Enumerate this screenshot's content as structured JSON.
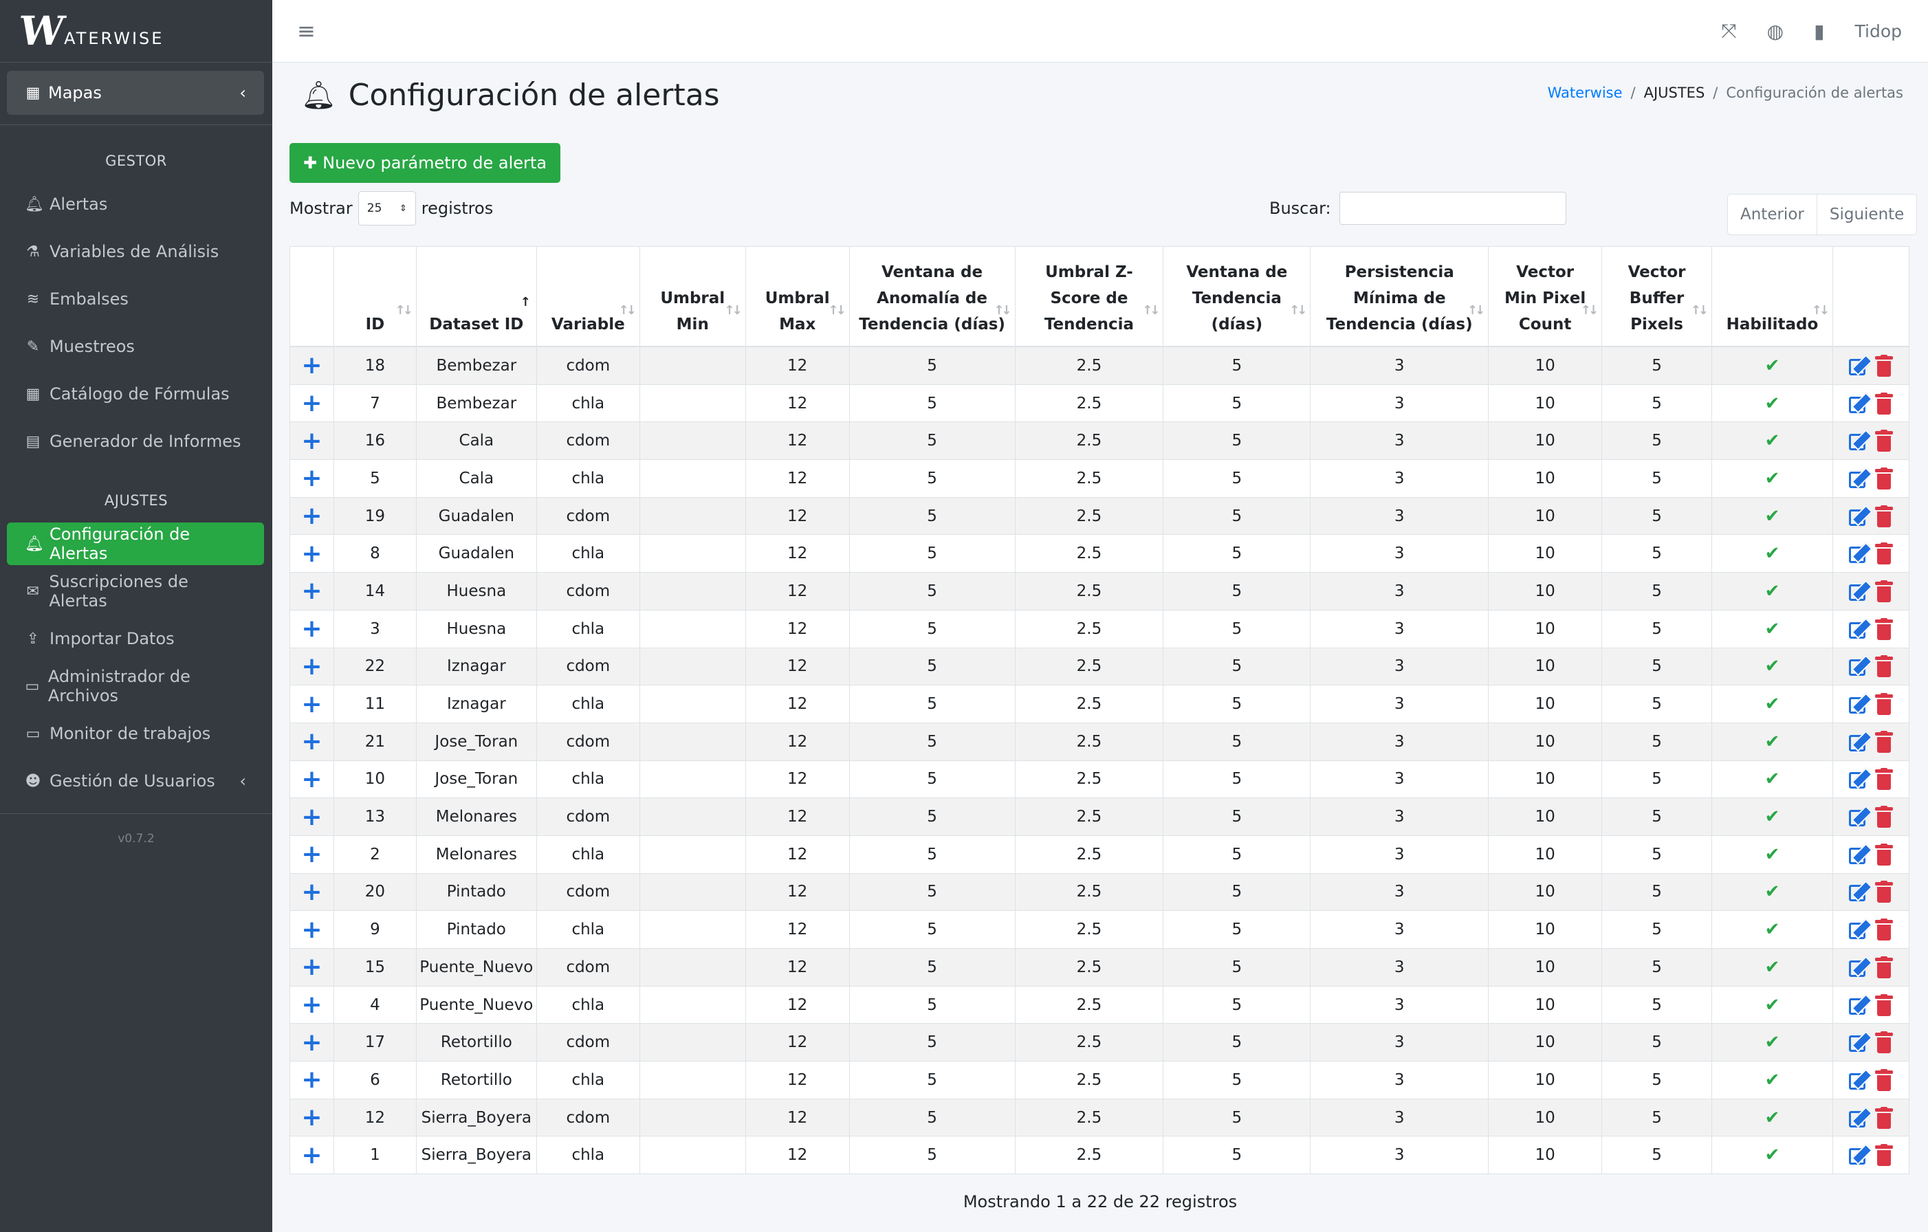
{
  "brand": {
    "logo_letter": "W",
    "logo_text": "ATERWISE"
  },
  "sidebar": {
    "mapas": "Mapas",
    "gestor_header": "GESTOR",
    "gestor_items": [
      {
        "label": "Alertas",
        "icon": "bell-icon"
      },
      {
        "label": "Variables de Análisis",
        "icon": "flask-icon"
      },
      {
        "label": "Embalses",
        "icon": "water-icon"
      },
      {
        "label": "Muestreos",
        "icon": "eyedropper-icon"
      },
      {
        "label": "Catálogo de Fórmulas",
        "icon": "calculator-icon"
      },
      {
        "label": "Generador de Informes",
        "icon": "file-icon"
      }
    ],
    "ajustes_header": "AJUSTES",
    "ajustes_items": [
      {
        "label": "Configuración de Alertas",
        "icon": "bell-icon"
      },
      {
        "label": "Suscripciones de Alertas",
        "icon": "envelope-icon"
      },
      {
        "label": "Importar Datos",
        "icon": "upload-icon"
      },
      {
        "label": "Administrador de Archivos",
        "icon": "folder-icon"
      },
      {
        "label": "Monitor de trabajos",
        "icon": "desktop-icon"
      },
      {
        "label": "Gestión de Usuarios",
        "icon": "users-icon"
      }
    ],
    "version": "v0.7.2"
  },
  "topbar": {
    "user": "Tidop"
  },
  "page": {
    "title": "Configuración de alertas",
    "breadcrumb": [
      "Waterwise",
      "/",
      "AJUSTES",
      "/",
      "Configuración de alertas"
    ],
    "new_button": "Nuevo parámetro de alerta",
    "show_label": "Mostrar",
    "show_value": "25",
    "records_label": "registros",
    "search_label": "Buscar:",
    "prev": "Anterior",
    "next": "Siguiente",
    "footer": "Mostrando 1 a 22 de 22 registros"
  },
  "table": {
    "headers": [
      [
        "ID"
      ],
      [
        "Dataset ID"
      ],
      [
        "Variable"
      ],
      [
        "Umbral",
        "Min"
      ],
      [
        "Umbral",
        "Max"
      ],
      [
        "Ventana de",
        "Anomalía de",
        "Tendencia (días)"
      ],
      [
        "Umbral Z-",
        "Score de",
        "Tendencia"
      ],
      [
        "Ventana de",
        "Tendencia",
        "(días)"
      ],
      [
        "Persistencia",
        "Mínima de",
        "Tendencia (días)"
      ],
      [
        "Vector",
        "Min Pixel",
        "Count"
      ],
      [
        "Vector",
        "Buffer",
        "Pixels"
      ],
      [
        "Habilitado"
      ]
    ],
    "rows": [
      {
        "id": "18",
        "dataset": "Bembezar",
        "variable": "cdom",
        "umin": "",
        "umax": "12",
        "vat": "5",
        "z": "2.5",
        "vt": "5",
        "pmt": "3",
        "vmp": "10",
        "vbp": "5"
      },
      {
        "id": "7",
        "dataset": "Bembezar",
        "variable": "chla",
        "umin": "",
        "umax": "12",
        "vat": "5",
        "z": "2.5",
        "vt": "5",
        "pmt": "3",
        "vmp": "10",
        "vbp": "5"
      },
      {
        "id": "16",
        "dataset": "Cala",
        "variable": "cdom",
        "umin": "",
        "umax": "12",
        "vat": "5",
        "z": "2.5",
        "vt": "5",
        "pmt": "3",
        "vmp": "10",
        "vbp": "5"
      },
      {
        "id": "5",
        "dataset": "Cala",
        "variable": "chla",
        "umin": "",
        "umax": "12",
        "vat": "5",
        "z": "2.5",
        "vt": "5",
        "pmt": "3",
        "vmp": "10",
        "vbp": "5"
      },
      {
        "id": "19",
        "dataset": "Guadalen",
        "variable": "cdom",
        "umin": "",
        "umax": "12",
        "vat": "5",
        "z": "2.5",
        "vt": "5",
        "pmt": "3",
        "vmp": "10",
        "vbp": "5"
      },
      {
        "id": "8",
        "dataset": "Guadalen",
        "variable": "chla",
        "umin": "",
        "umax": "12",
        "vat": "5",
        "z": "2.5",
        "vt": "5",
        "pmt": "3",
        "vmp": "10",
        "vbp": "5"
      },
      {
        "id": "14",
        "dataset": "Huesna",
        "variable": "cdom",
        "umin": "",
        "umax": "12",
        "vat": "5",
        "z": "2.5",
        "vt": "5",
        "pmt": "3",
        "vmp": "10",
        "vbp": "5"
      },
      {
        "id": "3",
        "dataset": "Huesna",
        "variable": "chla",
        "umin": "",
        "umax": "12",
        "vat": "5",
        "z": "2.5",
        "vt": "5",
        "pmt": "3",
        "vmp": "10",
        "vbp": "5"
      },
      {
        "id": "22",
        "dataset": "Iznagar",
        "variable": "cdom",
        "umin": "",
        "umax": "12",
        "vat": "5",
        "z": "2.5",
        "vt": "5",
        "pmt": "3",
        "vmp": "10",
        "vbp": "5"
      },
      {
        "id": "11",
        "dataset": "Iznagar",
        "variable": "chla",
        "umin": "",
        "umax": "12",
        "vat": "5",
        "z": "2.5",
        "vt": "5",
        "pmt": "3",
        "vmp": "10",
        "vbp": "5"
      },
      {
        "id": "21",
        "dataset": "Jose_Toran",
        "variable": "cdom",
        "umin": "",
        "umax": "12",
        "vat": "5",
        "z": "2.5",
        "vt": "5",
        "pmt": "3",
        "vmp": "10",
        "vbp": "5"
      },
      {
        "id": "10",
        "dataset": "Jose_Toran",
        "variable": "chla",
        "umin": "",
        "umax": "12",
        "vat": "5",
        "z": "2.5",
        "vt": "5",
        "pmt": "3",
        "vmp": "10",
        "vbp": "5"
      },
      {
        "id": "13",
        "dataset": "Melonares",
        "variable": "cdom",
        "umin": "",
        "umax": "12",
        "vat": "5",
        "z": "2.5",
        "vt": "5",
        "pmt": "3",
        "vmp": "10",
        "vbp": "5"
      },
      {
        "id": "2",
        "dataset": "Melonares",
        "variable": "chla",
        "umin": "",
        "umax": "12",
        "vat": "5",
        "z": "2.5",
        "vt": "5",
        "pmt": "3",
        "vmp": "10",
        "vbp": "5"
      },
      {
        "id": "20",
        "dataset": "Pintado",
        "variable": "cdom",
        "umin": "",
        "umax": "12",
        "vat": "5",
        "z": "2.5",
        "vt": "5",
        "pmt": "3",
        "vmp": "10",
        "vbp": "5"
      },
      {
        "id": "9",
        "dataset": "Pintado",
        "variable": "chla",
        "umin": "",
        "umax": "12",
        "vat": "5",
        "z": "2.5",
        "vt": "5",
        "pmt": "3",
        "vmp": "10",
        "vbp": "5"
      },
      {
        "id": "15",
        "dataset": "Puente_Nuevo",
        "variable": "cdom",
        "umin": "",
        "umax": "12",
        "vat": "5",
        "z": "2.5",
        "vt": "5",
        "pmt": "3",
        "vmp": "10",
        "vbp": "5"
      },
      {
        "id": "4",
        "dataset": "Puente_Nuevo",
        "variable": "chla",
        "umin": "",
        "umax": "12",
        "vat": "5",
        "z": "2.5",
        "vt": "5",
        "pmt": "3",
        "vmp": "10",
        "vbp": "5"
      },
      {
        "id": "17",
        "dataset": "Retortillo",
        "variable": "cdom",
        "umin": "",
        "umax": "12",
        "vat": "5",
        "z": "2.5",
        "vt": "5",
        "pmt": "3",
        "vmp": "10",
        "vbp": "5"
      },
      {
        "id": "6",
        "dataset": "Retortillo",
        "variable": "chla",
        "umin": "",
        "umax": "12",
        "vat": "5",
        "z": "2.5",
        "vt": "5",
        "pmt": "3",
        "vmp": "10",
        "vbp": "5"
      },
      {
        "id": "12",
        "dataset": "Sierra_Boyera",
        "variable": "cdom",
        "umin": "",
        "umax": "12",
        "vat": "5",
        "z": "2.5",
        "vt": "5",
        "pmt": "3",
        "vmp": "10",
        "vbp": "5"
      },
      {
        "id": "1",
        "dataset": "Sierra_Boyera",
        "variable": "chla",
        "umin": "",
        "umax": "12",
        "vat": "5",
        "z": "2.5",
        "vt": "5",
        "pmt": "3",
        "vmp": "10",
        "vbp": "5"
      }
    ]
  },
  "colors": {
    "sidebar": "#343a40",
    "accent": "#28a745",
    "link": "#007bff",
    "edit": "#1f6fde",
    "delete": "#dc3545"
  }
}
